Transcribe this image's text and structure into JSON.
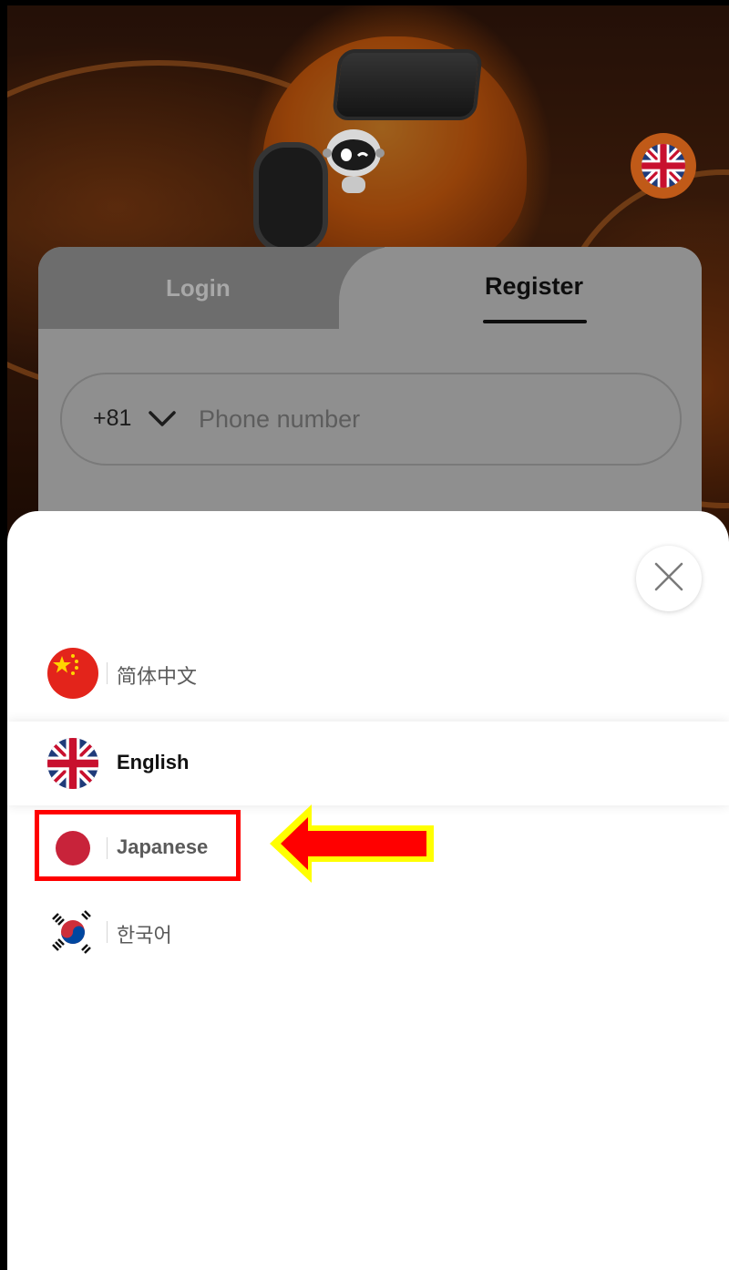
{
  "header": {
    "mascot_icon": "robot-mascot-icon",
    "language_button_icon": "uk-flag-icon"
  },
  "auth_card": {
    "tabs": [
      {
        "label": "Login",
        "active": false
      },
      {
        "label": "Register",
        "active": true
      }
    ],
    "phone": {
      "country_code": "+81",
      "placeholder": "Phone number"
    }
  },
  "language_sheet": {
    "close_icon": "close-icon",
    "languages": [
      {
        "label": "简体中文",
        "flag": "china-flag-icon",
        "selected": false
      },
      {
        "label": "English",
        "flag": "uk-flag-icon",
        "selected": true
      },
      {
        "label": "Japanese",
        "flag": "japan-flag-icon",
        "selected": false
      },
      {
        "label": "한국어",
        "flag": "korea-flag-icon",
        "selected": false
      }
    ]
  },
  "annotation": {
    "highlight_color": "#ff0000",
    "arrow_fill": "#ff0000",
    "arrow_outline": "#ffff00"
  }
}
